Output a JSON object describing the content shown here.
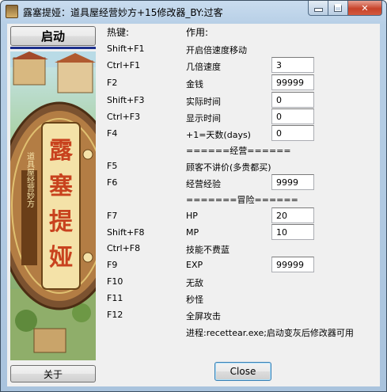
{
  "window": {
    "title": "露塞提娅：道具屋经营妙方+15修改器_BY:过客"
  },
  "buttons": {
    "start": "启动",
    "about": "关于",
    "close": "Close"
  },
  "columns": {
    "hotkey": "热键:",
    "action": "作用:"
  },
  "rows": [
    {
      "key": "Shift+F1",
      "action": "开启倍速度移动"
    },
    {
      "key": "Ctrl+F1",
      "action": "几倍速度",
      "value": "3"
    },
    {
      "key": "F2",
      "action": "金钱",
      "value": "99999"
    },
    {
      "key": "Shift+F3",
      "action": "实际时间",
      "value": "0"
    },
    {
      "key": "Ctrl+F3",
      "action": "显示时间",
      "value": "0"
    },
    {
      "key": "F4",
      "action": "+1=天数(days)",
      "value": "0"
    },
    {
      "key": "F5",
      "action": "顾客不讲价(多贵都买)"
    },
    {
      "key": "F6",
      "action": "经营经验",
      "value": "9999"
    },
    {
      "key": "F7",
      "action": "HP",
      "value": "20"
    },
    {
      "key": "Shift+F8",
      "action": "MP",
      "value": "10"
    },
    {
      "key": "Ctrl+F8",
      "action": "技能不费蓝"
    },
    {
      "key": "F9",
      "action": "EXP",
      "value": "99999"
    },
    {
      "key": "F10",
      "action": "无敌"
    },
    {
      "key": "F11",
      "action": "秒怪"
    },
    {
      "key": "F12",
      "action": "全屏攻击"
    }
  ],
  "sections": {
    "business": "======经营======",
    "adventure": "=======冒险======"
  },
  "note": "进程:recettear.exe;启动变灰后修改器可用",
  "art": {
    "title_text": "露塞提娅",
    "subtitle_text": "道具屋经营妙方"
  },
  "colors": {
    "title_bar": "#b9d1ea",
    "start_underline": "#1c2f8c",
    "art_logo": "#c8421e"
  }
}
